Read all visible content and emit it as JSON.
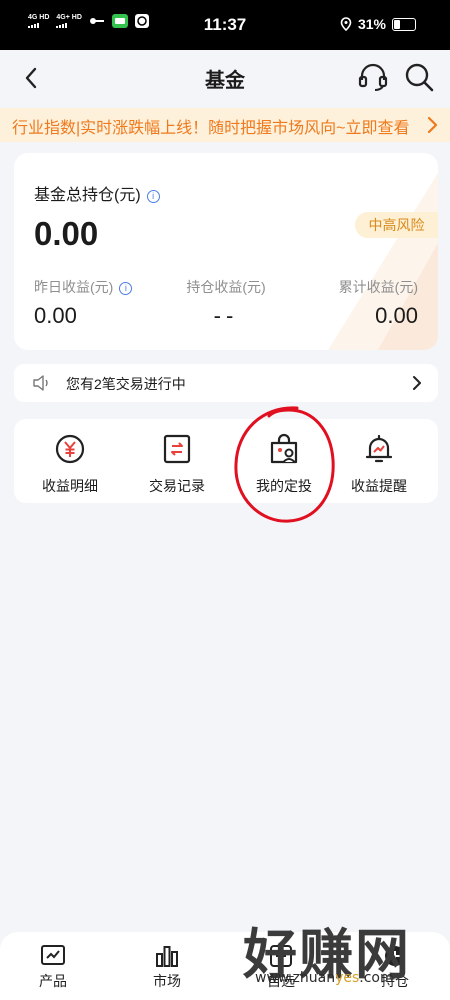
{
  "status_bar": {
    "time": "11:37",
    "battery": "31%",
    "network_1": "4G HD",
    "network_2": "4G+ HD"
  },
  "nav": {
    "title": "基金",
    "back_icon": "back-arrow-icon",
    "support_icon": "headset-icon",
    "search_icon": "search-icon"
  },
  "banner": {
    "text": "行业指数|实时涨跌幅上线！随时把握市场风向~立即查看"
  },
  "holdings": {
    "total_label": "基金总持仓(元)",
    "total_value": "0.00",
    "risk_tag": "中高风险",
    "stats": [
      {
        "label": "昨日收益(元)",
        "value": "0.00"
      },
      {
        "label": "持仓收益(元)",
        "value": "--"
      },
      {
        "label": "累计收益(元)",
        "value": "0.00"
      }
    ]
  },
  "notice": {
    "text": "您有2笔交易进行中"
  },
  "tools": [
    {
      "label": "收益明细",
      "icon": "yen-coin-icon"
    },
    {
      "label": "交易记录",
      "icon": "transfer-record-icon"
    },
    {
      "label": "我的定投",
      "icon": "investment-bag-icon"
    },
    {
      "label": "收益提醒",
      "icon": "bell-alert-icon"
    }
  ],
  "tabbar": [
    {
      "label": "产品",
      "icon": "chart-frame-icon"
    },
    {
      "label": "市场",
      "icon": "bar-chart-icon"
    },
    {
      "label": "自选",
      "icon": "plus-box-icon"
    },
    {
      "label": "持仓",
      "icon": "holdings-icon"
    }
  ],
  "watermark": {
    "main": "好赚网",
    "site_prefix": "www.zhuan",
    "site_accent": "yes",
    "site_suffix": ".com"
  },
  "colors": {
    "accent_orange": "#ef7a1d",
    "risk_tag": "#d98a1b",
    "icon_red": "#e8413c",
    "annotation_red": "#e01020",
    "info_blue": "#4a7ee6"
  }
}
